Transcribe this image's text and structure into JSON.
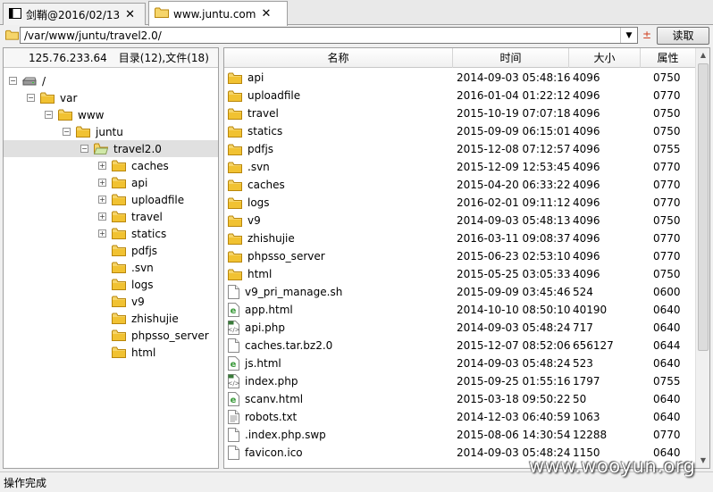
{
  "tabs": [
    {
      "label": "剑鞘@2016/02/13",
      "active": false
    },
    {
      "label": "www.juntu.com",
      "active": true
    }
  ],
  "address": {
    "path": "/var/www/juntu/travel2.0/",
    "plusminus": "±",
    "read_label": "读取"
  },
  "left_panel": {
    "ip": "125.76.233.64",
    "summary": "目录(12),文件(18)"
  },
  "tree": [
    {
      "label": "/",
      "depth": 0,
      "icon": "drive-icon",
      "expander": "−"
    },
    {
      "label": "var",
      "depth": 1,
      "icon": "folder-icon",
      "expander": "−"
    },
    {
      "label": "www",
      "depth": 2,
      "icon": "folder-icon",
      "expander": "−"
    },
    {
      "label": "juntu",
      "depth": 3,
      "icon": "folder-icon",
      "expander": "−"
    },
    {
      "label": "travel2.0",
      "depth": 4,
      "icon": "folder-open-icon",
      "expander": "−",
      "selected": true
    },
    {
      "label": "caches",
      "depth": 5,
      "icon": "folder-icon",
      "expander": "+"
    },
    {
      "label": "api",
      "depth": 5,
      "icon": "folder-icon",
      "expander": "+"
    },
    {
      "label": "uploadfile",
      "depth": 5,
      "icon": "folder-icon",
      "expander": "+"
    },
    {
      "label": "travel",
      "depth": 5,
      "icon": "folder-icon",
      "expander": "+"
    },
    {
      "label": "statics",
      "depth": 5,
      "icon": "folder-icon",
      "expander": "+"
    },
    {
      "label": "pdfjs",
      "depth": 5,
      "icon": "folder-icon",
      "expander": ""
    },
    {
      "label": ".svn",
      "depth": 5,
      "icon": "folder-icon",
      "expander": ""
    },
    {
      "label": "logs",
      "depth": 5,
      "icon": "folder-icon",
      "expander": ""
    },
    {
      "label": "v9",
      "depth": 5,
      "icon": "folder-icon",
      "expander": ""
    },
    {
      "label": "zhishujie",
      "depth": 5,
      "icon": "folder-icon",
      "expander": ""
    },
    {
      "label": "phpsso_server",
      "depth": 5,
      "icon": "folder-icon",
      "expander": ""
    },
    {
      "label": "html",
      "depth": 5,
      "icon": "folder-icon",
      "expander": ""
    }
  ],
  "columns": {
    "name": "名称",
    "time": "时间",
    "size": "大小",
    "attr": "属性"
  },
  "files": [
    {
      "name": "api",
      "time": "2014-09-03 05:48:16",
      "size": "4096",
      "attr": "0750",
      "icon": "folder-icon"
    },
    {
      "name": "uploadfile",
      "time": "2016-01-04 01:22:12",
      "size": "4096",
      "attr": "0770",
      "icon": "folder-icon"
    },
    {
      "name": "travel",
      "time": "2015-10-19 07:07:18",
      "size": "4096",
      "attr": "0750",
      "icon": "folder-icon"
    },
    {
      "name": "statics",
      "time": "2015-09-09 06:15:01",
      "size": "4096",
      "attr": "0750",
      "icon": "folder-icon"
    },
    {
      "name": "pdfjs",
      "time": "2015-12-08 07:12:57",
      "size": "4096",
      "attr": "0755",
      "icon": "folder-icon"
    },
    {
      "name": ".svn",
      "time": "2015-12-09 12:53:45",
      "size": "4096",
      "attr": "0770",
      "icon": "folder-icon"
    },
    {
      "name": "caches",
      "time": "2015-04-20 06:33:22",
      "size": "4096",
      "attr": "0770",
      "icon": "folder-icon"
    },
    {
      "name": "logs",
      "time": "2016-02-01 09:11:12",
      "size": "4096",
      "attr": "0770",
      "icon": "folder-icon"
    },
    {
      "name": "v9",
      "time": "2014-09-03 05:48:13",
      "size": "4096",
      "attr": "0750",
      "icon": "folder-icon"
    },
    {
      "name": "zhishujie",
      "time": "2016-03-11 09:08:37",
      "size": "4096",
      "attr": "0770",
      "icon": "folder-icon"
    },
    {
      "name": "phpsso_server",
      "time": "2015-06-23 02:53:10",
      "size": "4096",
      "attr": "0770",
      "icon": "folder-icon"
    },
    {
      "name": "html",
      "time": "2015-05-25 03:05:33",
      "size": "4096",
      "attr": "0750",
      "icon": "folder-icon"
    },
    {
      "name": "v9_pri_manage.sh",
      "time": "2015-09-09 03:45:46",
      "size": "524",
      "attr": "0600",
      "icon": "file-icon"
    },
    {
      "name": "app.html",
      "time": "2014-10-10 08:50:10",
      "size": "40190",
      "attr": "0640",
      "icon": "html-file-icon"
    },
    {
      "name": "api.php",
      "time": "2014-09-03 05:48:24",
      "size": "717",
      "attr": "0640",
      "icon": "php-file-icon"
    },
    {
      "name": "caches.tar.bz2.0",
      "time": "2015-12-07 08:52:06",
      "size": "656127",
      "attr": "0644",
      "icon": "file-icon"
    },
    {
      "name": "js.html",
      "time": "2014-09-03 05:48:24",
      "size": "523",
      "attr": "0640",
      "icon": "html-file-icon"
    },
    {
      "name": "index.php",
      "time": "2015-09-25 01:55:16",
      "size": "1797",
      "attr": "0755",
      "icon": "php-file-icon"
    },
    {
      "name": "scanv.html",
      "time": "2015-03-18 09:50:22",
      "size": "50",
      "attr": "0640",
      "icon": "html-file-icon"
    },
    {
      "name": "robots.txt",
      "time": "2014-12-03 06:40:59",
      "size": "1063",
      "attr": "0640",
      "icon": "text-file-icon"
    },
    {
      "name": ".index.php.swp",
      "time": "2015-08-06 14:30:54",
      "size": "12288",
      "attr": "0770",
      "icon": "file-icon"
    },
    {
      "name": "favicon.ico",
      "time": "2014-09-03 05:48:24",
      "size": "1150",
      "attr": "0640",
      "icon": "file-icon"
    }
  ],
  "status": {
    "text": "操作完成"
  },
  "watermark": "www.wooyun.org",
  "colors": {
    "folder": "#f1c232",
    "folder_border": "#b8860b",
    "html_icon": "#3a9a3a",
    "php_icon": "#3a7a3a"
  }
}
